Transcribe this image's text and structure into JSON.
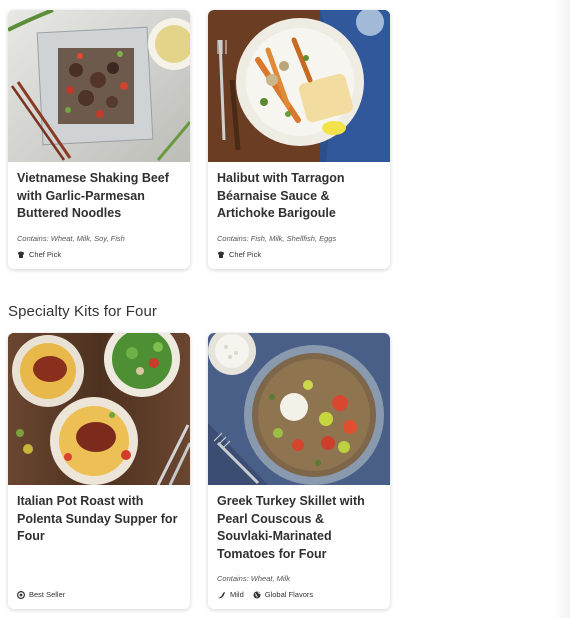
{
  "cards_top": [
    {
      "title": "Vietnamese Shaking Beef with Garlic-Parmesan Buttered Noodles",
      "contains": "Contains: Wheat, Milk, Soy, Fish",
      "tags": [
        {
          "icon": "chef-hat-icon",
          "label": "Chef Pick"
        }
      ],
      "image": "vietnamese-shaking-beef-photo"
    },
    {
      "title": "Halibut with Tarragon Béarnaise Sauce & Artichoke Barigoule",
      "contains": "Contains: Fish, Milk, Shellfish, Eggs",
      "tags": [
        {
          "icon": "chef-hat-icon",
          "label": "Chef Pick"
        }
      ],
      "image": "halibut-photo"
    }
  ],
  "section": {
    "title": "Specialty Kits for Four"
  },
  "cards_bottom": [
    {
      "title": "Italian Pot Roast with Polenta Sunday Supper for Four",
      "contains": "",
      "tags": [
        {
          "icon": "best-seller-icon",
          "label": "Best Seller"
        }
      ],
      "image": "italian-pot-roast-photo"
    },
    {
      "title": "Greek Turkey Skillet with Pearl Couscous & Souvlaki-Marinated Tomatoes for Four",
      "contains": "Contains: Wheat, Milk",
      "tags": [
        {
          "icon": "chili-pepper-icon",
          "label": "Mild"
        },
        {
          "icon": "globe-icon",
          "label": "Global Flavors"
        }
      ],
      "image": "greek-turkey-skillet-photo"
    }
  ]
}
